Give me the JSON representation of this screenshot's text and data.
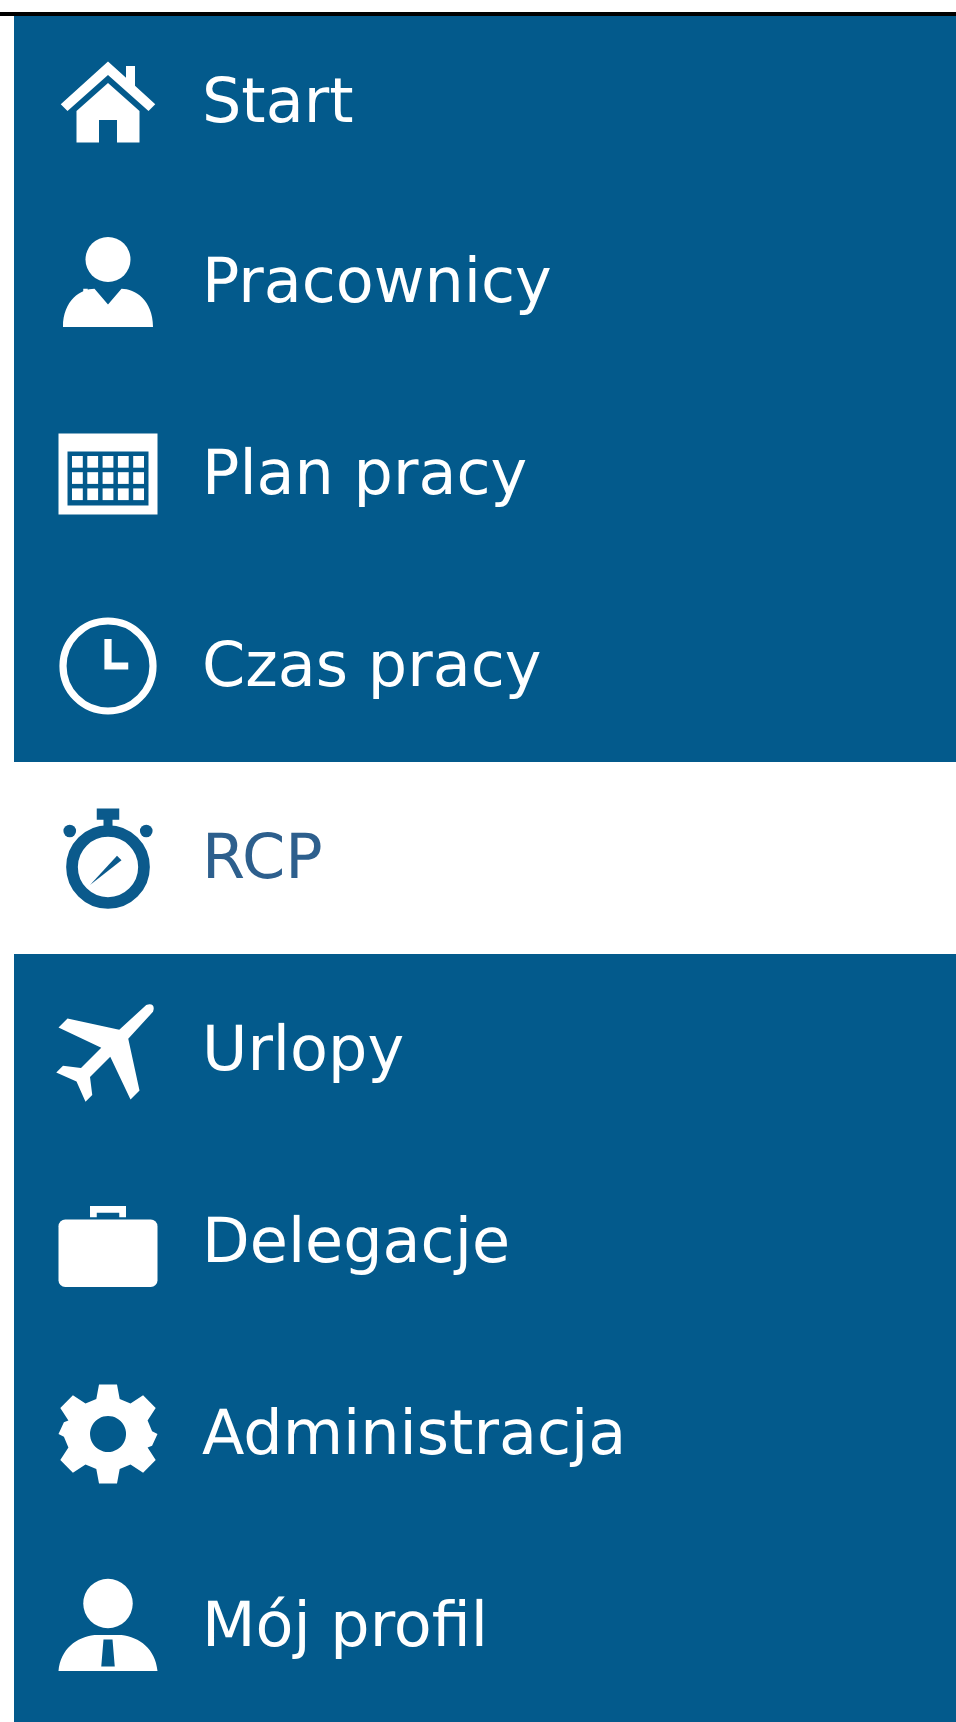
{
  "menu": [
    {
      "label": "Start",
      "selected": false
    },
    {
      "label": "Pracownicy",
      "selected": false
    },
    {
      "label": "Plan pracy",
      "selected": false
    },
    {
      "label": "Czas pracy",
      "selected": false
    },
    {
      "label": "RCP",
      "selected": true
    },
    {
      "label": "Urlopy",
      "selected": false
    },
    {
      "label": "Delegacje",
      "selected": false
    },
    {
      "label": "Administracja",
      "selected": false
    },
    {
      "label": "Mój profil",
      "selected": false
    }
  ]
}
